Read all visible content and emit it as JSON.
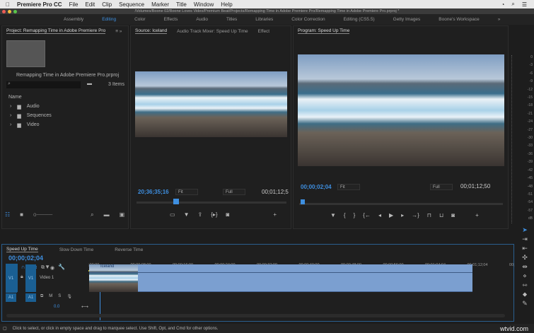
{
  "menubar": {
    "app": "Premiere Pro CC",
    "items": [
      "File",
      "Edit",
      "Clip",
      "Sequence",
      "Marker",
      "Title",
      "Window",
      "Help"
    ]
  },
  "window_title": "/Volumes/Boone 02/Boone Loves Video/Premium Beat/Projects/Remapping Time in Adobe Premiere Pro/Remapping Time in Adobe Premiere Pro.prproj *",
  "workspaces": [
    "Assembly",
    "Editing",
    "Color",
    "Effects",
    "Audio",
    "Titles",
    "Libraries",
    "Color Correction",
    "Editing (CS5.5)",
    "Getty Images",
    "Boone's Workspace"
  ],
  "workspace_active": "Editing",
  "project": {
    "tab": "Project: Remapping Time in Adobe Premiere Pro",
    "file": "Remapping Time in Adobe Premiere Pro.prproj",
    "search_placeholder": "",
    "count": "3 Items",
    "col_name": "Name",
    "items": [
      "Audio",
      "Sequences",
      "Video"
    ]
  },
  "source": {
    "tabs": [
      "Source: Iceland",
      "Audio Track Mixer: Speed Up Time",
      "Effect"
    ],
    "timecode": "20;36;35;16",
    "fit": "Fit",
    "quality": "Full",
    "duration": "00;01;12;5"
  },
  "program": {
    "tab": "Program: Speed Up Time",
    "timecode": "00;00;02;04",
    "fit": "Fit",
    "quality": "Full",
    "duration": "00;01;12;50"
  },
  "meters": [
    "0",
    "-3",
    "-6",
    "-9",
    "-12",
    "-15",
    "-18",
    "-21",
    "-24",
    "-27",
    "-30",
    "-33",
    "-36",
    "-39",
    "-42",
    "-45",
    "-48",
    "-51",
    "-54",
    "-57",
    "dB"
  ],
  "timeline": {
    "tabs": [
      "Speed Up Time",
      "Slow Down Time",
      "Reverse Time"
    ],
    "timecode": "00;00;02;04",
    "ruler": [
      ";00;00",
      "00;00;08;00",
      "00;00;16;00",
      "00;00;24;00",
      "00;00;32;00",
      "00;00;40;00",
      "00;00;48;00",
      "00;00;56;00",
      "00;01;04;04",
      "00;01;12;04",
      "00;"
    ],
    "v1": "V1",
    "video1": "Video 1",
    "a1": "A1",
    "volume": "0.0",
    "clip": "Iceland",
    "playhead_fraction": 0.02
  },
  "status": "Click to select, or click in empty space and drag to marquee select. Use Shift, Opt, and Cmd for other options.",
  "watermark": "wtvid.com"
}
